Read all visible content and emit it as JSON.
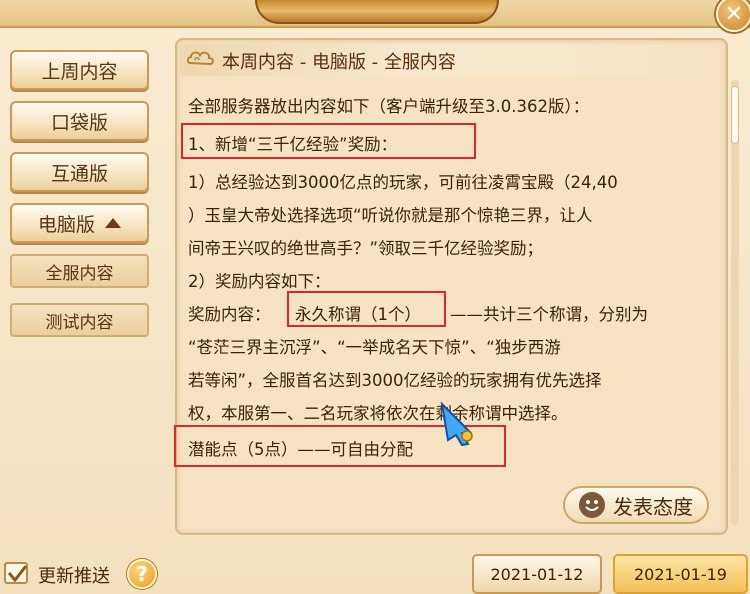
{
  "close_label": "✕",
  "sidebar": {
    "items": [
      {
        "label": "上周内容"
      },
      {
        "label": "口袋版"
      },
      {
        "label": "互通版"
      },
      {
        "label": "电脑版"
      }
    ],
    "subitems": [
      {
        "label": "全服内容"
      },
      {
        "label": "测试内容"
      }
    ]
  },
  "content": {
    "header": "本周内容 - 电脑版 - 全服内容",
    "lines": [
      "全部服务器放出内容如下（客户端升级至3.0.362版）：",
      "1、新增“三千亿经验”奖励：",
      "1）总经验达到3000亿点的玩家，可前往凌霄宝殿（24,40",
      "）玉皇大帝处选择选项“听说你就是那个惊艳三界，让人",
      "间帝王兴叹的绝世高手？”领取三千亿经验奖励；",
      "2）奖励内容如下：",
      "奖励内容：",
      "永久称谓（1个）",
      "——共计三个称谓，分别为",
      "“苍茫三界主沉浮”、“一举成名天下惊”、“独步西游",
      "若等闲”，全服首名达到3000亿经验的玩家拥有优先选择",
      "权，本服第一、二名玩家将依次在剩余称谓中选择。",
      "潜能点（5点）——可自由分配"
    ]
  },
  "comment_button": "发表态度",
  "footer": {
    "push_label": "更新推送",
    "help_label": "?",
    "dates": [
      "2021-01-12",
      "2021-01-19"
    ]
  },
  "colors": {
    "highlight_box": "#e0262b",
    "text": "#3e2208",
    "accent": "#f4bf55"
  }
}
